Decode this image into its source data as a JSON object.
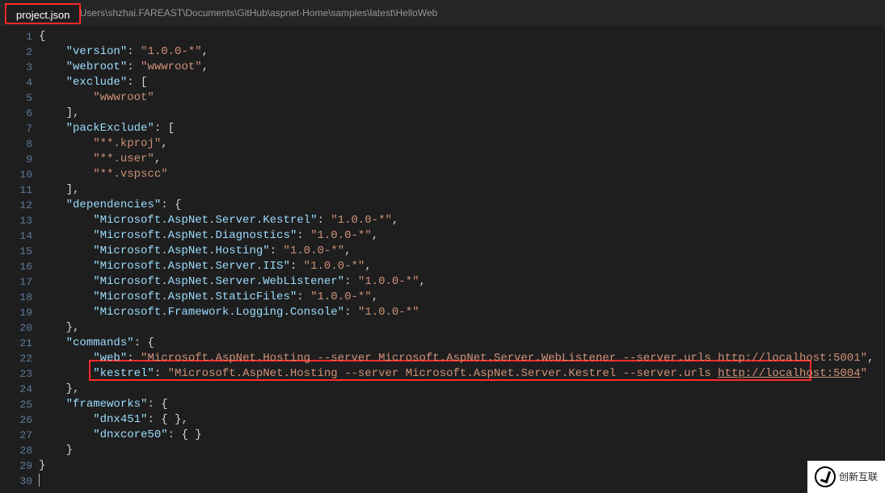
{
  "tab": {
    "title": "project.json"
  },
  "filePath": ":\\Users\\shzhai.FAREAST\\Documents\\GitHub\\aspnet-Home\\samples\\latest\\HelloWeb",
  "lineNumbers": [
    "1",
    "2",
    "3",
    "4",
    "5",
    "6",
    "7",
    "8",
    "9",
    "10",
    "11",
    "12",
    "13",
    "14",
    "15",
    "16",
    "17",
    "18",
    "19",
    "20",
    "21",
    "22",
    "23",
    "24",
    "25",
    "26",
    "27",
    "28",
    "29",
    "30"
  ],
  "code": {
    "l1_open": "{",
    "l2_key": "\"version\"",
    "l2_val": "\"1.0.0-*\"",
    "l3_key": "\"webroot\"",
    "l3_val": "\"wwwroot\"",
    "l4_key": "\"exclude\"",
    "l5_val": "\"wwwroot\"",
    "l6": "],",
    "l7_key": "\"packExclude\"",
    "l8_val": "\"**.kproj\"",
    "l9_val": "\"**.user\"",
    "l10_val": "\"**.vspscc\"",
    "l11": "],",
    "l12_key": "\"dependencies\"",
    "l13_key": "\"Microsoft.AspNet.Server.Kestrel\"",
    "l13_val": "\"1.0.0-*\"",
    "l14_key": "\"Microsoft.AspNet.Diagnostics\"",
    "l14_val": "\"1.0.0-*\"",
    "l15_key": "\"Microsoft.AspNet.Hosting\"",
    "l15_val": "\"1.0.0-*\"",
    "l16_key": "\"Microsoft.AspNet.Server.IIS\"",
    "l16_val": "\"1.0.0-*\"",
    "l17_key": "\"Microsoft.AspNet.Server.WebListener\"",
    "l17_val": "\"1.0.0-*\"",
    "l18_key": "\"Microsoft.AspNet.StaticFiles\"",
    "l18_val": "\"1.0.0-*\"",
    "l19_key": "\"Microsoft.Framework.Logging.Console\"",
    "l19_val": "\"1.0.0-*\"",
    "l20": "},",
    "l21_key": "\"commands\"",
    "l22_key": "\"web\"",
    "l22_val_a": "\"Microsoft.AspNet.Hosting --server Microsoft.AspNet.Server.WebListener --server.urls http://localhost:5001\"",
    "l23_key": "\"kestrel\"",
    "l23_val_a": "\"Microsoft.AspNet.Hosting --server Microsoft.AspNet.Server.Kestrel --server.urls ",
    "l23_url": "http://localhost:5004",
    "l23_val_b": "\"",
    "l24": "},",
    "l25_key": "\"frameworks\"",
    "l26_key": "\"dnx451\"",
    "l27_key": "\"dnxcore50\"",
    "l28": "}",
    "l29": "}"
  },
  "watermark": {
    "text": "创新互联"
  }
}
